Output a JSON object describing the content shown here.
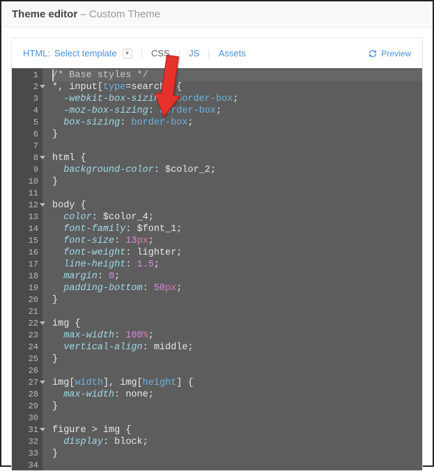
{
  "header": {
    "title": "Theme editor",
    "subtitle": "– Custom Theme"
  },
  "toolbar": {
    "html_label": "HTML:",
    "select_template": "Select template",
    "tabs": {
      "css": "CSS",
      "js": "JS",
      "assets": "Assets"
    },
    "preview": "Preview"
  },
  "editor": {
    "first_line": 1,
    "lines": [
      {
        "n": 1,
        "fold": false,
        "tokens": [
          [
            "comment",
            "/* Base styles */"
          ]
        ]
      },
      {
        "n": 2,
        "fold": true,
        "tokens": [
          [
            "sel",
            "*"
          ],
          [
            "punc",
            ", "
          ],
          [
            "sel",
            "input"
          ],
          [
            "punc",
            "["
          ],
          [
            "attr",
            "type"
          ],
          [
            "punc",
            "="
          ],
          [
            "sel",
            "search"
          ],
          [
            "punc",
            "]"
          ],
          [
            "punc",
            " "
          ],
          [
            "brace",
            "{"
          ]
        ]
      },
      {
        "n": 3,
        "fold": false,
        "tokens": [
          [
            "pad",
            "  "
          ],
          [
            "prop",
            "-webkit-box-sizing"
          ],
          [
            "punc",
            ": "
          ],
          [
            "kw",
            "border-box"
          ],
          [
            "punc",
            ";"
          ]
        ]
      },
      {
        "n": 4,
        "fold": false,
        "tokens": [
          [
            "pad",
            "  "
          ],
          [
            "prop",
            "-moz-box-sizing"
          ],
          [
            "punc",
            ": "
          ],
          [
            "kw",
            "border-box"
          ],
          [
            "punc",
            ";"
          ]
        ]
      },
      {
        "n": 5,
        "fold": false,
        "tokens": [
          [
            "pad",
            "  "
          ],
          [
            "prop",
            "box-sizing"
          ],
          [
            "punc",
            ": "
          ],
          [
            "kw",
            "border-box"
          ],
          [
            "punc",
            ";"
          ]
        ]
      },
      {
        "n": 6,
        "fold": false,
        "tokens": [
          [
            "brace",
            "}"
          ]
        ]
      },
      {
        "n": 7,
        "fold": false,
        "tokens": []
      },
      {
        "n": 8,
        "fold": true,
        "tokens": [
          [
            "sel",
            "html"
          ],
          [
            "punc",
            " "
          ],
          [
            "brace",
            "{"
          ]
        ]
      },
      {
        "n": 9,
        "fold": false,
        "tokens": [
          [
            "pad",
            "  "
          ],
          [
            "prop",
            "background-color"
          ],
          [
            "punc",
            ": "
          ],
          [
            "var",
            "$color_2"
          ],
          [
            "punc",
            ";"
          ]
        ]
      },
      {
        "n": 10,
        "fold": false,
        "tokens": [
          [
            "brace",
            "}"
          ]
        ]
      },
      {
        "n": 11,
        "fold": false,
        "tokens": []
      },
      {
        "n": 12,
        "fold": true,
        "tokens": [
          [
            "sel",
            "body"
          ],
          [
            "punc",
            " "
          ],
          [
            "brace",
            "{"
          ]
        ]
      },
      {
        "n": 13,
        "fold": false,
        "tokens": [
          [
            "pad",
            "  "
          ],
          [
            "prop",
            "color"
          ],
          [
            "punc",
            ": "
          ],
          [
            "var",
            "$color_4"
          ],
          [
            "punc",
            ";"
          ]
        ]
      },
      {
        "n": 14,
        "fold": false,
        "tokens": [
          [
            "pad",
            "  "
          ],
          [
            "prop",
            "font-family"
          ],
          [
            "punc",
            ": "
          ],
          [
            "var",
            "$font_1"
          ],
          [
            "punc",
            ";"
          ]
        ]
      },
      {
        "n": 15,
        "fold": false,
        "tokens": [
          [
            "pad",
            "  "
          ],
          [
            "prop",
            "font-size"
          ],
          [
            "punc",
            ": "
          ],
          [
            "num",
            "13"
          ],
          [
            "unit",
            "px"
          ],
          [
            "punc",
            ";"
          ]
        ]
      },
      {
        "n": 16,
        "fold": false,
        "tokens": [
          [
            "pad",
            "  "
          ],
          [
            "prop",
            "font-weight"
          ],
          [
            "punc",
            ": "
          ],
          [
            "val",
            "lighter"
          ],
          [
            "punc",
            ";"
          ]
        ]
      },
      {
        "n": 17,
        "fold": false,
        "tokens": [
          [
            "pad",
            "  "
          ],
          [
            "prop",
            "line-height"
          ],
          [
            "punc",
            ": "
          ],
          [
            "num",
            "1.5"
          ],
          [
            "punc",
            ";"
          ]
        ]
      },
      {
        "n": 18,
        "fold": false,
        "tokens": [
          [
            "pad",
            "  "
          ],
          [
            "prop",
            "margin"
          ],
          [
            "punc",
            ": "
          ],
          [
            "num",
            "0"
          ],
          [
            "punc",
            ";"
          ]
        ]
      },
      {
        "n": 19,
        "fold": false,
        "tokens": [
          [
            "pad",
            "  "
          ],
          [
            "prop",
            "padding-bottom"
          ],
          [
            "punc",
            ": "
          ],
          [
            "num",
            "50"
          ],
          [
            "unit",
            "px"
          ],
          [
            "punc",
            ";"
          ]
        ]
      },
      {
        "n": 20,
        "fold": false,
        "tokens": [
          [
            "brace",
            "}"
          ]
        ]
      },
      {
        "n": 21,
        "fold": false,
        "tokens": []
      },
      {
        "n": 22,
        "fold": true,
        "tokens": [
          [
            "sel",
            "img"
          ],
          [
            "punc",
            " "
          ],
          [
            "brace",
            "{"
          ]
        ]
      },
      {
        "n": 23,
        "fold": false,
        "tokens": [
          [
            "pad",
            "  "
          ],
          [
            "prop",
            "max-width"
          ],
          [
            "punc",
            ": "
          ],
          [
            "num",
            "100"
          ],
          [
            "pct",
            "%"
          ],
          [
            "punc",
            ";"
          ]
        ]
      },
      {
        "n": 24,
        "fold": false,
        "tokens": [
          [
            "pad",
            "  "
          ],
          [
            "prop",
            "vertical-align"
          ],
          [
            "punc",
            ": "
          ],
          [
            "val",
            "middle"
          ],
          [
            "punc",
            ";"
          ]
        ]
      },
      {
        "n": 25,
        "fold": false,
        "tokens": [
          [
            "brace",
            "}"
          ]
        ]
      },
      {
        "n": 26,
        "fold": false,
        "tokens": []
      },
      {
        "n": 27,
        "fold": true,
        "tokens": [
          [
            "sel",
            "img"
          ],
          [
            "punc",
            "["
          ],
          [
            "attr",
            "width"
          ],
          [
            "punc",
            "]"
          ],
          [
            "punc",
            ", "
          ],
          [
            "sel",
            "img"
          ],
          [
            "punc",
            "["
          ],
          [
            "attr",
            "height"
          ],
          [
            "punc",
            "]"
          ],
          [
            "punc",
            " "
          ],
          [
            "brace",
            "{"
          ]
        ]
      },
      {
        "n": 28,
        "fold": false,
        "tokens": [
          [
            "pad",
            "  "
          ],
          [
            "prop",
            "max-width"
          ],
          [
            "punc",
            ": "
          ],
          [
            "val",
            "none"
          ],
          [
            "punc",
            ";"
          ]
        ]
      },
      {
        "n": 29,
        "fold": false,
        "tokens": [
          [
            "brace",
            "}"
          ]
        ]
      },
      {
        "n": 30,
        "fold": false,
        "tokens": []
      },
      {
        "n": 31,
        "fold": true,
        "tokens": [
          [
            "sel",
            "figure"
          ],
          [
            "punc",
            " > "
          ],
          [
            "sel",
            "img"
          ],
          [
            "punc",
            " "
          ],
          [
            "brace",
            "{"
          ]
        ]
      },
      {
        "n": 32,
        "fold": false,
        "tokens": [
          [
            "pad",
            "  "
          ],
          [
            "prop",
            "display"
          ],
          [
            "punc",
            ": "
          ],
          [
            "val",
            "block"
          ],
          [
            "punc",
            ";"
          ]
        ]
      },
      {
        "n": 33,
        "fold": false,
        "tokens": [
          [
            "brace",
            "}"
          ]
        ]
      },
      {
        "n": 34,
        "fold": false,
        "tokens": []
      }
    ]
  }
}
